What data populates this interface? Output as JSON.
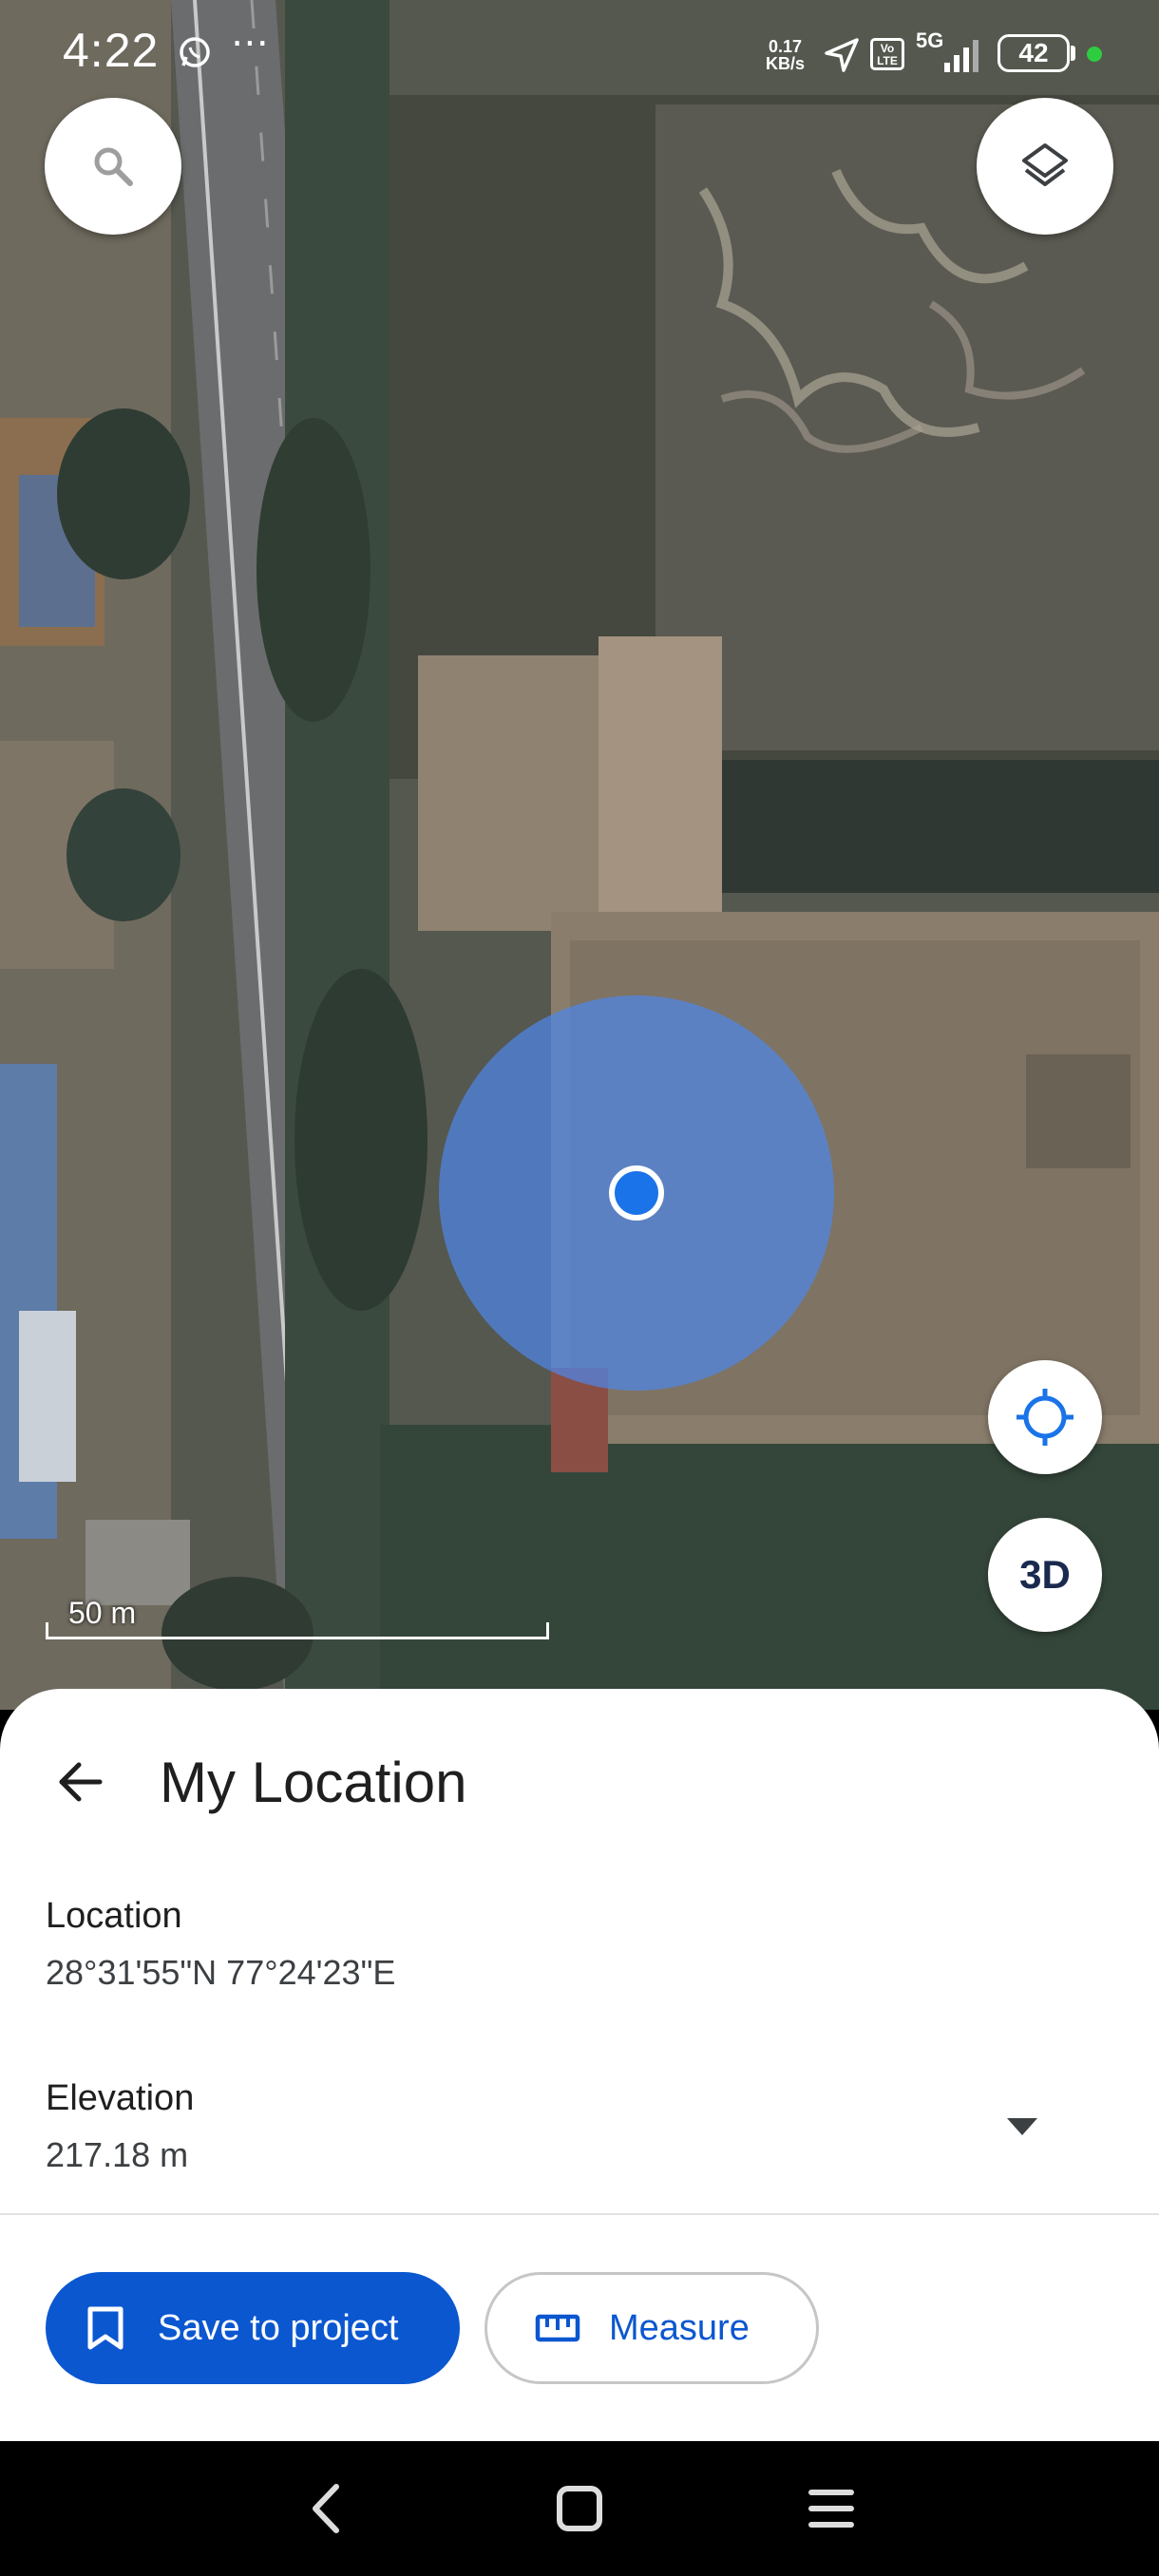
{
  "status_bar": {
    "time": "4:22",
    "net_speed_value": "0.17",
    "net_speed_unit": "KB/s",
    "volte_line1": "Vo",
    "volte_line2": "LTE",
    "network": "5G",
    "battery": "42",
    "icons": [
      "whatsapp-icon",
      "more-dots-icon",
      "navigation-arrow-icon",
      "volte-icon",
      "signal-icon",
      "battery-icon"
    ]
  },
  "map": {
    "search_icon": "search-icon",
    "layers_icon": "layers-icon",
    "locate_icon": "my-location-icon",
    "three_d_label": "3D",
    "scale_label": "50 m",
    "colors": {
      "location_halo": "#4f86e8",
      "location_dot": "#1a73e8"
    }
  },
  "sheet": {
    "title": "My Location",
    "location_label": "Location",
    "location_value": "28°31'55\"N 77°24'23\"E",
    "elevation_label": "Elevation",
    "elevation_value": "217.18 m",
    "save_button": "Save to project",
    "measure_button": "Measure",
    "colors": {
      "primary": "#0b57d0"
    }
  },
  "nav_bar": {
    "icons": [
      "back-nav-icon",
      "home-nav-icon",
      "recents-nav-icon"
    ]
  }
}
